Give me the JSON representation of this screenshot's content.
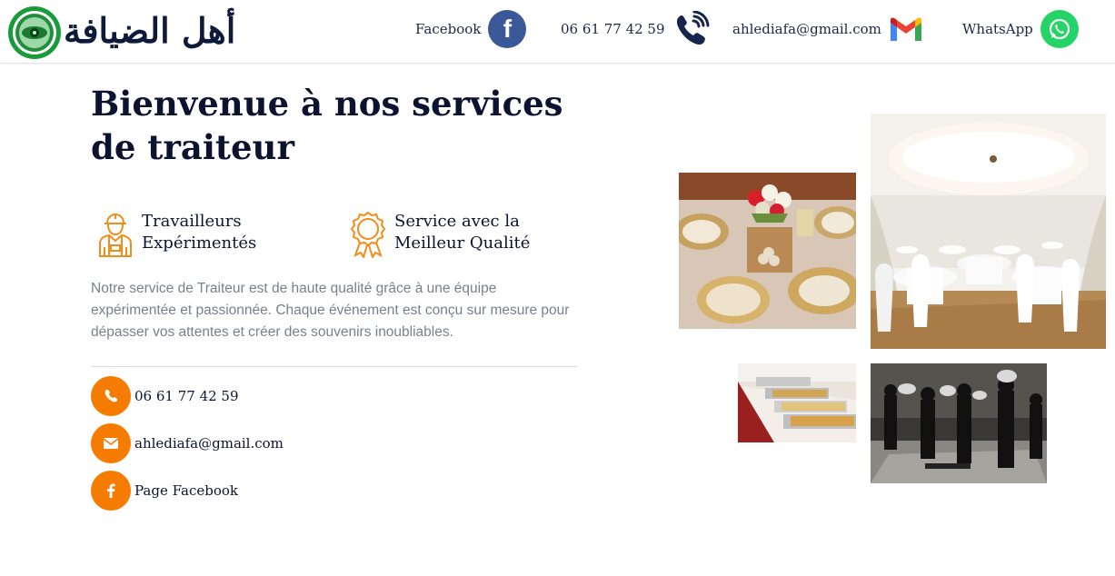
{
  "brand": {
    "logo_text": "أهل الضيافة",
    "colors": {
      "navy": "#0b1330",
      "accent_orange": "#f57c00",
      "facebook_blue": "#3b5998",
      "whatsapp_green": "#25d366",
      "logo_green": "#1a9b3a"
    }
  },
  "header": {
    "facebook": {
      "label": "Facebook",
      "icon": "facebook-icon"
    },
    "phone": {
      "label": "06 61 77 42 59",
      "icon": "phone-icon"
    },
    "email": {
      "label": "ahlediafa@gmail.com",
      "icon": "gmail-icon"
    },
    "whatsapp": {
      "label": "WhatsApp",
      "icon": "whatsapp-icon"
    }
  },
  "main": {
    "title": "Bienvenue à nos services de traiteur",
    "features": [
      {
        "icon": "worker-icon",
        "line1": "Travailleurs",
        "line2": "Expérimentés"
      },
      {
        "icon": "quality-badge-icon",
        "line1": "Service avec la",
        "line2": "Meilleur Qualité"
      }
    ],
    "description": "Notre service de Traiteur est de haute qualité grâce à une équipe expérimentée et passionnée. Chaque événement est conçu sur mesure pour dépasser vos attentes et créer des souvenirs inoubliables.",
    "contacts": [
      {
        "icon": "phone-icon",
        "label": "06 61 77 42 59"
      },
      {
        "icon": "envelope-icon",
        "label": "ahlediafa@gmail.com"
      },
      {
        "icon": "facebook-icon",
        "label": "Page Facebook"
      }
    ]
  },
  "gallery": [
    {
      "name": "table-setting-photo"
    },
    {
      "name": "banquet-hall-photo"
    },
    {
      "name": "buffet-trays-photo"
    },
    {
      "name": "waiters-service-photo"
    }
  ]
}
